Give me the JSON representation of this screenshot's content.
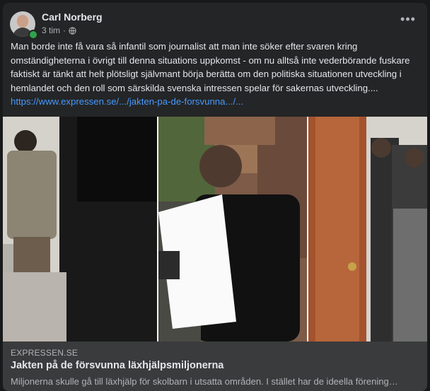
{
  "post": {
    "author": "Carl Norberg",
    "time": "3 tim",
    "separator": "·",
    "text": "Man borde inte få vara så infantil som journalist att man inte söker efter svaren kring omständigheterna i övrigt till denna situations uppkomst - om nu alltså inte vederbörande fuskare faktiskt är tänkt att helt plötsligt självmant börja berätta om den politiska situationen utveckling i hemlandet och den roll som särskilda svenska intressen spelar för sakernas utveckling....",
    "link": "https://www.expressen.se/.../jakten-pa-de-forsvunna.../..."
  },
  "preview": {
    "domain": "EXPRESSEN.SE",
    "title": "Jakten på de försvunna läxhjälpsmiljonerna",
    "description": "Miljonerna skulle gå till läxhjälp för skolbarn i utsatta områden. I stället har de ideella förening…"
  },
  "colors": {
    "background": "#18191a",
    "card": "#242526",
    "link": "#4599ff",
    "online": "#31a24c"
  }
}
